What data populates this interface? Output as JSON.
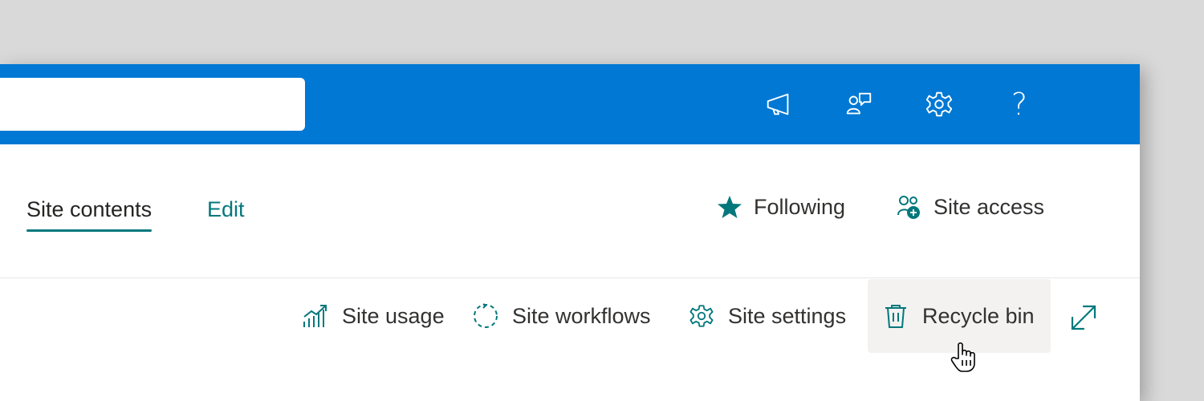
{
  "header": {
    "search": {
      "value": "",
      "placeholder": ""
    },
    "icons": [
      "megaphone-icon",
      "feedback-icon",
      "settings-icon",
      "help-icon"
    ],
    "help_glyph": "?"
  },
  "nav": {
    "tabs": [
      {
        "label": "Site contents",
        "active": true
      },
      {
        "label": "Edit",
        "active": false
      }
    ],
    "following_label": "Following",
    "site_access_label": "Site access"
  },
  "commands": {
    "site_usage": "Site usage",
    "site_workflows": "Site workflows",
    "site_settings": "Site settings",
    "recycle_bin": "Recycle bin"
  },
  "colors": {
    "topbar": "#0078d4",
    "accent": "#03787c",
    "text": "#323130",
    "hover_bg": "#f3f2f1"
  }
}
